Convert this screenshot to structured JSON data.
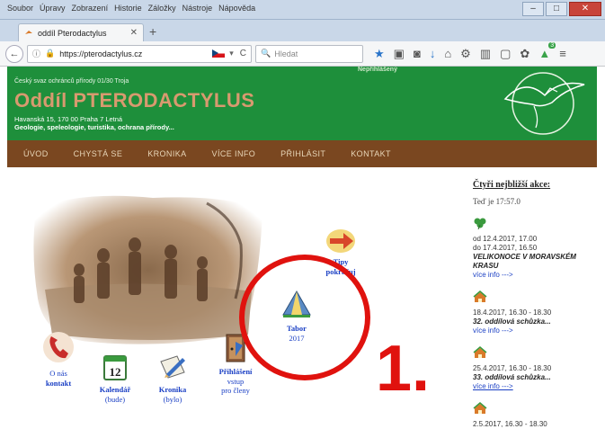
{
  "browser": {
    "menu": [
      "Soubor",
      "Úpravy",
      "Zobrazení",
      "Historie",
      "Záložky",
      "Nástroje",
      "Nápověda"
    ],
    "tab_title": "oddíl Pterodactylus",
    "url": "https://pterodactylus.cz",
    "search_placeholder": "Hledat"
  },
  "header": {
    "org_line": "Český svaz ochránců přírody 01/30 Troja",
    "title": "Oddíl PTERODACTYLUS",
    "address": "Havanská 15, 170 00 Praha 7 Letná",
    "tagline": "Geologie, speleologie, turistika, ochrana přírody...",
    "small_label": "Nepřihlášený"
  },
  "nav": [
    "ÚVOD",
    "CHYSTÁ SE",
    "KRONIKA",
    "VÍCE INFO",
    "PŘIHLÁSIT",
    "KONTAKT"
  ],
  "icons": {
    "next": {
      "line1": "Tipy",
      "line2": "pokračuj"
    },
    "tabor": {
      "line1": "Tabor",
      "line2": "2017"
    },
    "onas": {
      "line1": "O nás",
      "line2": "kontakt"
    },
    "kalendar": {
      "line1": "Kalendář",
      "line2": "(bude)"
    },
    "kronika": {
      "line1": "Kronika",
      "line2": "(bylo)"
    },
    "prihlaseni": {
      "line1": "Přihlášení",
      "line2": "vstup",
      "line3": "pro členy"
    }
  },
  "calendar_day": "12",
  "events": {
    "title": "Čtyři nejbližší akce:",
    "today": "Teď je 17:57.0",
    "items": [
      {
        "date": "od 12.4.2017, 17.00",
        "date2": "do 17.4.2017, 16.50",
        "title": "VELIKONOCE V MORAVSKÉM KRASU",
        "link": "více info --->",
        "icon_color": "#3a9a3e"
      },
      {
        "date": "18.4.2017, 16.30 - 18.30",
        "title": "32. oddílová schůzka...",
        "link": "více info --->",
        "icon_color": "#d97a2a"
      },
      {
        "date": "25.4.2017, 16.30 - 18.30",
        "title": "33. oddílová schůzka...",
        "link": "více info --->",
        "icon_color": "#d97a2a"
      },
      {
        "date": "2.5.2017, 16.30 - 18.30",
        "title": "",
        "link": "",
        "icon_color": "#d97a2a"
      }
    ]
  },
  "annotation": {
    "number": "1."
  },
  "colors": {
    "header_green": "#1e8f3b",
    "nav_brown": "#7a4720",
    "title_tan": "#d89a6f",
    "link_blue": "#1a3fc4",
    "annotation_red": "#e0120e"
  }
}
